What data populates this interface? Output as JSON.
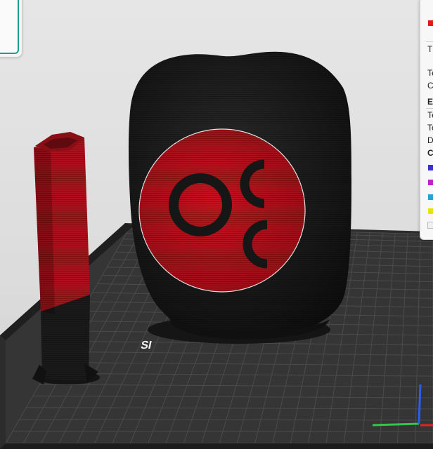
{
  "legend_panel": {
    "lines": [
      "T",
      "Te",
      "Co",
      "Es",
      "Te",
      "Te",
      "Di",
      "Cl"
    ],
    "swatch_colors": [
      "#e01818",
      "#3a2fd0",
      "#c020c8",
      "#2aa0d8",
      "#f0e000",
      "#f0f0f0"
    ]
  },
  "bed": {
    "label": "SI"
  },
  "model_colors": {
    "red": "#b3121b",
    "black": "#1a1a1a",
    "bed_plate": "#303030",
    "grid_line": "#4a4a4a"
  },
  "axes": {
    "x_color": "#2fc84a",
    "y_color": "#2b5fe8"
  }
}
